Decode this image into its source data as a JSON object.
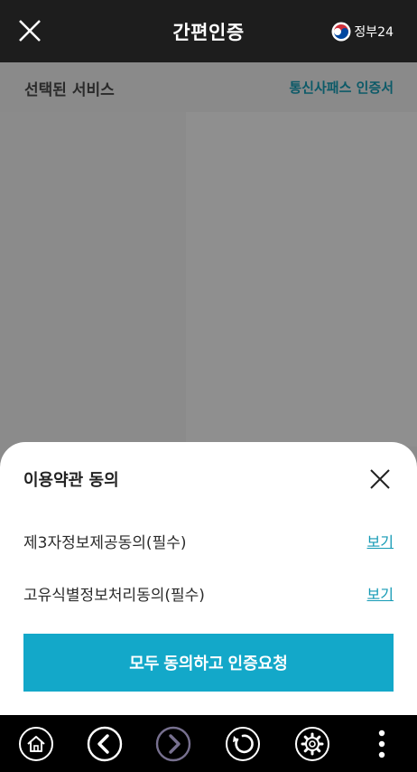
{
  "header": {
    "title": "간편인증",
    "gov_label": "정부24",
    "close_icon": "close-icon"
  },
  "subheader": {
    "selected_label": "선택된 서비스",
    "service_name": "통신사패스 인증서"
  },
  "sheet": {
    "title": "이용약관 동의",
    "items": [
      {
        "label": "제3자정보제공동의(필수)",
        "link": "보기"
      },
      {
        "label": "고유식별정보처리동의(필수)",
        "link": "보기"
      }
    ],
    "cta_label": "모두 동의하고 인증요청"
  },
  "toolbar": {
    "icons": [
      "home-icon",
      "back-icon",
      "forward-icon",
      "refresh-icon",
      "settings-icon",
      "more-icon"
    ]
  },
  "colors": {
    "header_bg": "#1d1d1d",
    "accent": "#13a8c9",
    "link": "#149ab5",
    "service_text": "#0c5a68"
  }
}
